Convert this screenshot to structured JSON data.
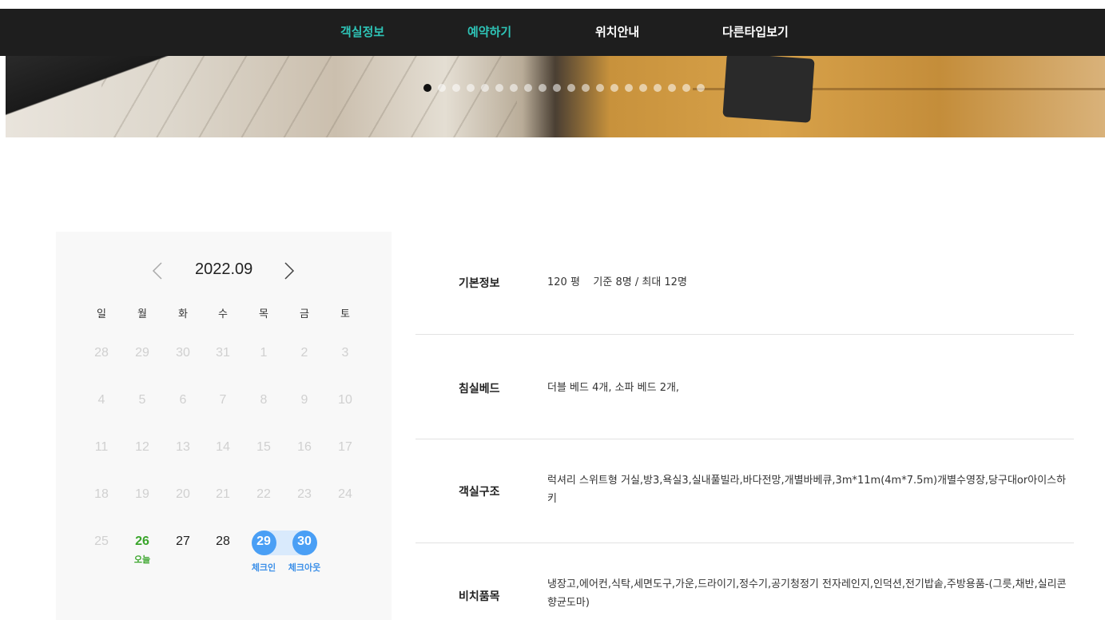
{
  "nav": {
    "items": [
      "객실정보",
      "예약하기",
      "위치안내",
      "다른타입보기"
    ]
  },
  "hero": {
    "dot_count": 20,
    "active_dot": 1
  },
  "calendar": {
    "month": "2022.09",
    "weekdays": [
      "일",
      "월",
      "화",
      "수",
      "목",
      "금",
      "토"
    ],
    "weeks": [
      [
        "28",
        "29",
        "30",
        "31",
        "1",
        "2",
        "3"
      ],
      [
        "4",
        "5",
        "6",
        "7",
        "8",
        "9",
        "10"
      ],
      [
        "11",
        "12",
        "13",
        "14",
        "15",
        "16",
        "17"
      ],
      [
        "18",
        "19",
        "20",
        "21",
        "22",
        "23",
        "24"
      ],
      [
        "25",
        "26",
        "27",
        "28",
        "29",
        "30",
        ""
      ]
    ],
    "today_label": "오늘",
    "checkin_label": "체크인",
    "checkout_label": "체크아웃",
    "colors": {
      "today": "#3aa52b",
      "selected": "#4a9ff5",
      "range": "#d9eafc"
    }
  },
  "room_info": {
    "basic": {
      "label": "기본정보",
      "value": "120 평    기준 8명 / 최대 12명"
    },
    "beds": {
      "label": "침실베드",
      "value": "더블 베드 4개, 소파 베드 2개,"
    },
    "structure": {
      "label": "객실구조",
      "value": "럭셔리 스위트형 거실,방3,욕실3,실내풀빌라,바다전망,개별바베큐,3m*11m(4m*7.5m)개별수영장,당구대or아이스하키"
    },
    "amenities": {
      "label": "비치품목",
      "value": "냉장고,에어컨,식탁,세면도구,가운,드라이기,정수기,공기청정기 전자레인지,인덕션,전기밥솥,주방용품-(그릇,채반,실리콘 향균도마)"
    }
  }
}
